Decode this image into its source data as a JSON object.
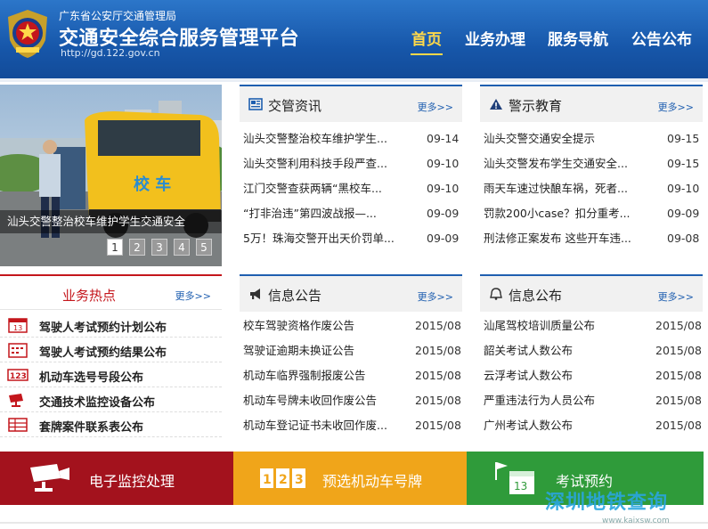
{
  "header": {
    "agency": "广东省公安厅交通管理局",
    "title": "交通安全综合服务管理平台",
    "url": "http://gd.122.gov.cn",
    "nav": [
      {
        "label": "首页",
        "active": true
      },
      {
        "label": "业务办理",
        "active": false
      },
      {
        "label": "服务导航",
        "active": false
      },
      {
        "label": "公告公布",
        "active": false
      }
    ]
  },
  "slideshow": {
    "caption": "汕头交警整治校车维护学生交通安全",
    "bus_text": "校 车",
    "pages": [
      "1",
      "2",
      "3",
      "4",
      "5"
    ],
    "active_page": 1
  },
  "panels": {
    "traffic_news": {
      "title": "交管资讯",
      "more": "更多>>",
      "items": [
        {
          "title": "汕头交警整治校车维护学生...",
          "date": "09-14"
        },
        {
          "title": "汕头交警利用科技手段严查...",
          "date": "09-10"
        },
        {
          "title": "江门交警查获两辆“黑校车...",
          "date": "09-10"
        },
        {
          "title": "“打非治违”第四波战报—...",
          "date": "09-09"
        },
        {
          "title": "5万！珠海交警开出天价罚单...",
          "date": "09-09"
        }
      ]
    },
    "warning_education": {
      "title": "警示教育",
      "more": "更多>>",
      "items": [
        {
          "title": "汕头交警交通安全提示",
          "date": "09-15"
        },
        {
          "title": "汕头交警发布学生交通安全...",
          "date": "09-15"
        },
        {
          "title": "雨天车速过快酿车祸，死者...",
          "date": "09-10"
        },
        {
          "title": "罚款200小case？扣分重考...",
          "date": "09-09"
        },
        {
          "title": "刑法修正案发布 这些开车违...",
          "date": "09-08"
        }
      ]
    },
    "info_notice": {
      "title": "信息公告",
      "more": "更多>>",
      "items": [
        {
          "title": "校车驾驶资格作废公告",
          "date": "2015/08"
        },
        {
          "title": "驾驶证逾期未换证公告",
          "date": "2015/08"
        },
        {
          "title": "机动车临界强制报废公告",
          "date": "2015/08"
        },
        {
          "title": "机动车号牌未收回作废公告",
          "date": "2015/08"
        },
        {
          "title": "机动车登记证书未收回作废...",
          "date": "2015/08"
        }
      ]
    },
    "info_publish": {
      "title": "信息公布",
      "more": "更多>>",
      "items": [
        {
          "title": "汕尾驾校培训质量公布",
          "date": "2015/08"
        },
        {
          "title": "韶关考试人数公布",
          "date": "2015/08"
        },
        {
          "title": "云浮考试人数公布",
          "date": "2015/08"
        },
        {
          "title": "严重违法行为人员公布",
          "date": "2015/08"
        },
        {
          "title": "广州考试人数公布",
          "date": "2015/08"
        }
      ]
    }
  },
  "hot": {
    "title": "业务热点",
    "more": "更多>>",
    "items": [
      {
        "label": "驾驶人考试预约计划公布",
        "icon": "calendar-13-icon"
      },
      {
        "label": "驾驶人考试预约结果公布",
        "icon": "calendar-list-icon"
      },
      {
        "label": "机动车选号号段公布",
        "icon": "number-123-icon"
      },
      {
        "label": "交通技术监控设备公布",
        "icon": "camera-icon"
      },
      {
        "label": "套牌案件联系表公布",
        "icon": "table-icon"
      }
    ],
    "cal_num": "13",
    "num_icon": "123"
  },
  "bottom_bar": {
    "items": [
      {
        "label": "电子监控处理",
        "icon": "surveillance-camera-icon",
        "color": "#a3121d"
      },
      {
        "label": "预选机动车号牌",
        "icon": "plate-number-icon",
        "color": "#f0a51a"
      },
      {
        "label": "考试预约",
        "icon": "calendar-flag-icon",
        "color": "#2f9b3a"
      }
    ],
    "plate_digits": [
      "1",
      "2",
      "3"
    ],
    "cal_num": "13"
  },
  "watermark": {
    "text": "深圳地铁查询",
    "url": "www.kaixsw.com"
  },
  "colors": {
    "header_blue": "#1757aa",
    "accent_yellow": "#ffd84a",
    "hot_red": "#c4161c",
    "link_blue": "#1f5fb0"
  }
}
